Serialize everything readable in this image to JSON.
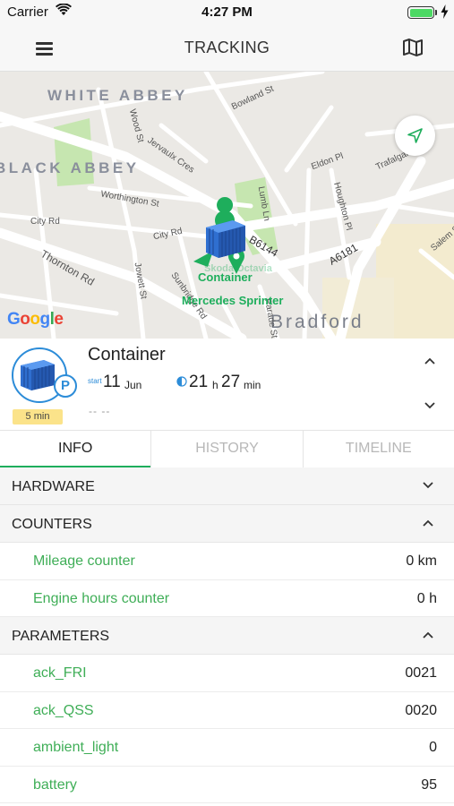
{
  "status_bar": {
    "carrier": "Carrier",
    "time": "4:27 PM",
    "battery_level": 1.0
  },
  "nav": {
    "title": "TRACKING",
    "menu_icon": "hamburger-menu-icon",
    "map_icon": "folded-map-icon"
  },
  "map": {
    "districts": [
      "WHITE ABBEY",
      "BLACK ABBEY"
    ],
    "city": "Bradford",
    "streets": [
      "Bowland St",
      "Wood St",
      "Jervaulx Cres",
      "Worthington St",
      "City Rd",
      "City Rd",
      "Thornton Rd",
      "Jowett St",
      "Sunbridge Rd",
      "Lumb Ln",
      "Eldon Pl",
      "Houghton Pl",
      "Trafalgar St",
      "Salem St",
      "Parade St"
    ],
    "roads": [
      "B6144",
      "A6181"
    ],
    "marker_label": "Container",
    "marker_label_behind": "Skoda Octavia",
    "marker_label_2": "Mercedes Sprinter",
    "attribution": "Google",
    "locate_icon": "navigation-arrow-icon",
    "accent_color": "#1eae5c"
  },
  "unit": {
    "name": "Container",
    "start_label": "start",
    "start_day": "11",
    "start_month": "Jun",
    "duration_hours": "21",
    "duration_hours_unit": "h",
    "duration_minutes": "27",
    "duration_minutes_unit": "min",
    "address": "-- --",
    "interval": "5 min",
    "parking_badge": "P"
  },
  "tabs": [
    {
      "label": "INFO",
      "active": true
    },
    {
      "label": "HISTORY",
      "active": false
    },
    {
      "label": "TIMELINE",
      "active": false
    }
  ],
  "sections": {
    "hardware": {
      "title": "HARDWARE",
      "expanded": false
    },
    "counters": {
      "title": "COUNTERS",
      "expanded": true,
      "rows": [
        {
          "label": "Mileage counter",
          "value": "0 km"
        },
        {
          "label": "Engine hours counter",
          "value": "0 h"
        }
      ]
    },
    "parameters": {
      "title": "PARAMETERS",
      "expanded": true,
      "rows": [
        {
          "label": "ack_FRI",
          "value": "0021"
        },
        {
          "label": "ack_QSS",
          "value": "0020"
        },
        {
          "label": "ambient_light",
          "value": "0"
        },
        {
          "label": "battery",
          "value": "95"
        }
      ]
    }
  },
  "colors": {
    "accent_green": "#1eae5c",
    "label_green": "#3fae57",
    "avatar_blue": "#2c8cd8",
    "badge_yellow": "#fbe38a"
  }
}
